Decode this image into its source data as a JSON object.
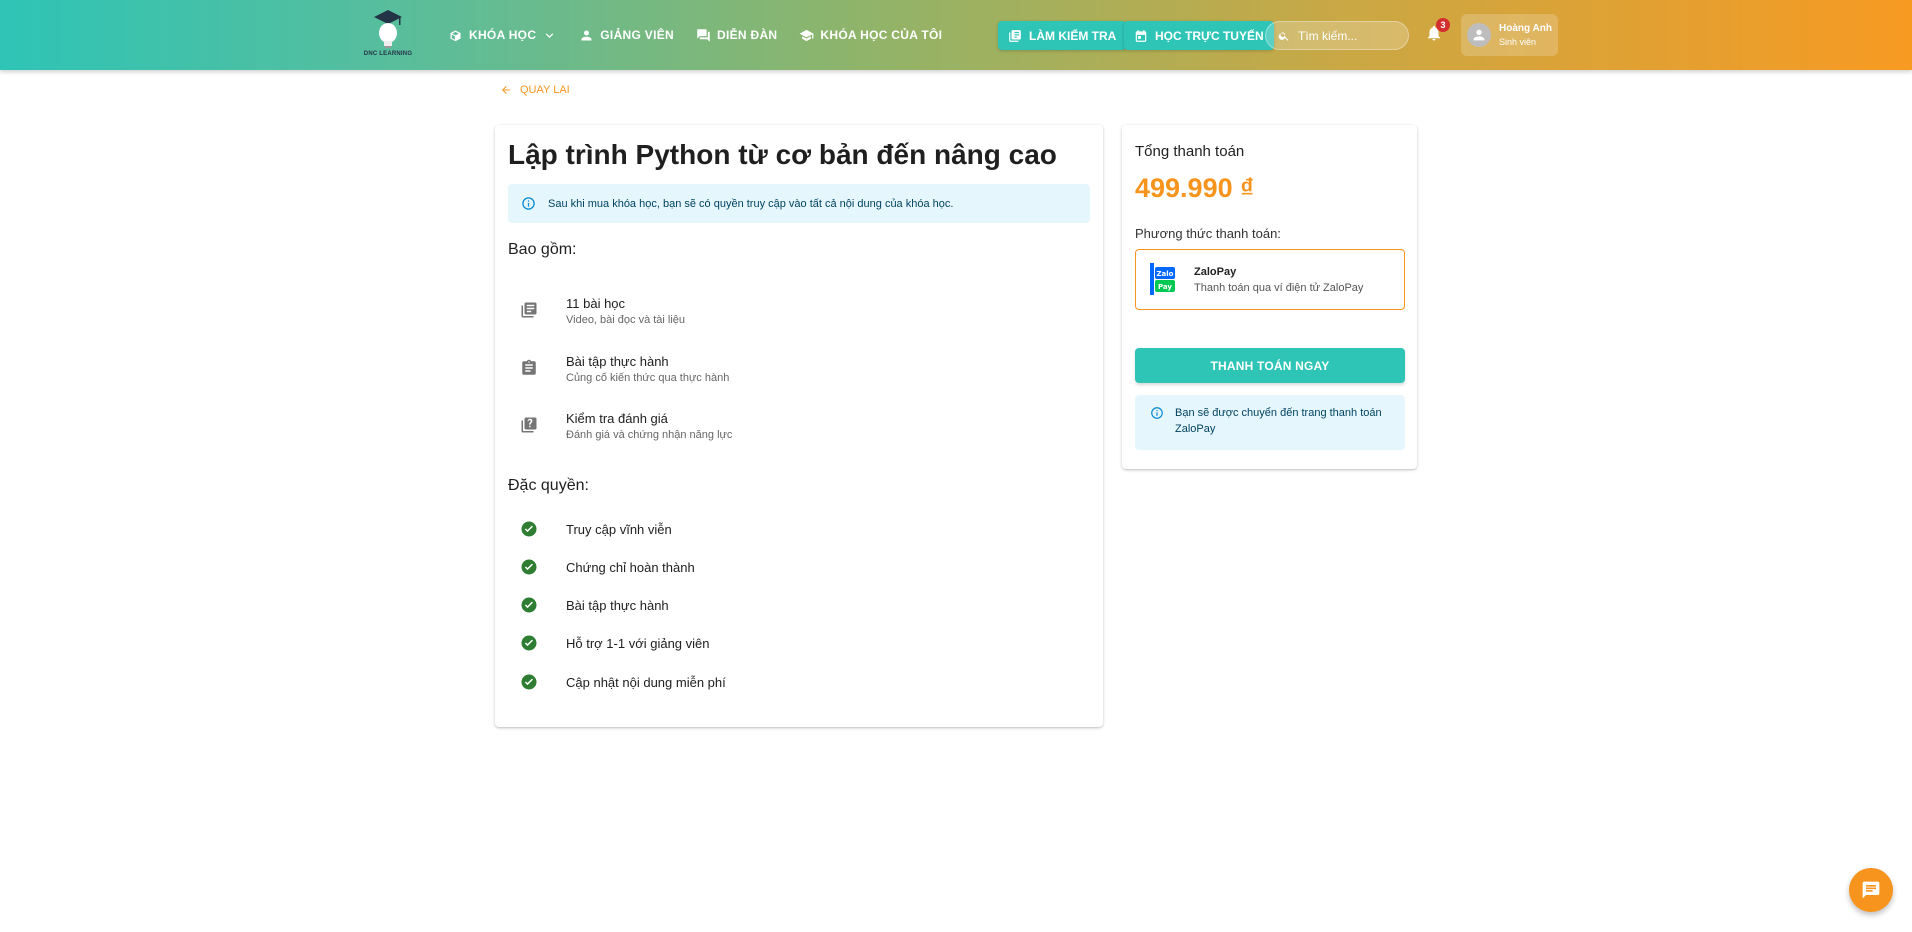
{
  "brand": {
    "name": "DNC LEARNING"
  },
  "nav": {
    "items": [
      {
        "label": "KHÓA HỌC",
        "icon": "book-open-icon",
        "has_dropdown": true
      },
      {
        "label": "GIẢNG VIÊN",
        "icon": "person-icon"
      },
      {
        "label": "DIỄN ĐÀN",
        "icon": "forum-icon"
      },
      {
        "label": "KHÓA HỌC CỦA TÔI",
        "icon": "school-icon"
      }
    ],
    "quiz_button": "LÀM KIỂM TRA",
    "online_button": "HỌC TRỰC TUYẾN",
    "search_placeholder": "Tìm kiếm...",
    "notification_count": "3",
    "user": {
      "name": "Hoàng Anh",
      "role": "Sinh viên"
    }
  },
  "back_label": "QUAY LẠI",
  "course": {
    "title": "Lập trình Python từ cơ bản đến nâng cao",
    "access_notice": "Sau khi mua khóa học, bạn sẽ có quyền truy cập vào tất cả nội dung của khóa học.",
    "includes_heading": "Bao gồm:",
    "includes": [
      {
        "title": "11 bài học",
        "subtitle": "Video, bài đọc và tài liệu",
        "icon": "library-books-icon"
      },
      {
        "title": "Bài tập thực hành",
        "subtitle": "Củng cố kiến thức qua thực hành",
        "icon": "assignment-icon"
      },
      {
        "title": "Kiểm tra đánh giá",
        "subtitle": "Đánh giá và chứng nhận năng lực",
        "icon": "quiz-icon"
      }
    ],
    "privileges_heading": "Đặc quyền:",
    "privileges": [
      "Truy cập vĩnh viễn",
      "Chứng chỉ hoàn thành",
      "Bài tập thực hành",
      "Hỗ trợ 1-1 với giảng viên",
      "Cập nhật nội dung miễn phí"
    ]
  },
  "payment": {
    "total_label": "Tổng thanh toán",
    "total_price": "499.990 ₫",
    "method_label": "Phương thức thanh toán:",
    "method": {
      "name": "ZaloPay",
      "description": "Thanh toán qua ví điện tử ZaloPay"
    },
    "pay_button": "THANH TOÁN NGAY",
    "redirect_notice": "Bạn sẽ được chuyển đến trang thanh toán ZaloPay"
  },
  "colors": {
    "primary": "#2ec4b6",
    "accent": "#f7941d",
    "success": "#2e7d32",
    "info_bg": "#e5f6fd"
  }
}
